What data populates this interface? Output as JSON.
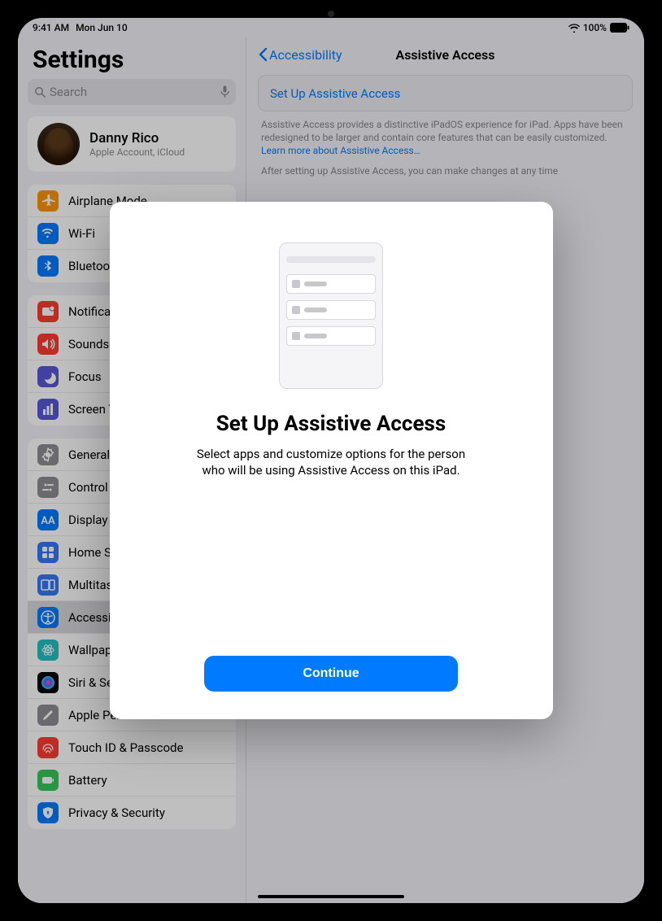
{
  "status": {
    "time": "9:41 AM",
    "date": "Mon Jun 10",
    "battery": "100%",
    "wifi": true
  },
  "sidebar": {
    "title": "Settings",
    "search_placeholder": "Search",
    "profile": {
      "name": "Danny Rico",
      "subtitle": "Apple Account, iCloud"
    },
    "sections": [
      {
        "items": [
          {
            "label": "Airplane Mode",
            "icon_color": "#ff9500",
            "icon_name": "airplane-icon"
          },
          {
            "label": "Wi-Fi",
            "icon_color": "#007aff",
            "icon_name": "wifi-icon"
          },
          {
            "label": "Bluetooth",
            "icon_color": "#007aff",
            "icon_name": "bluetooth-icon"
          }
        ]
      },
      {
        "items": [
          {
            "label": "Notifications",
            "icon_color": "#ff3b30",
            "icon_name": "notifications-icon"
          },
          {
            "label": "Sounds",
            "icon_color": "#ff3b30",
            "icon_name": "sounds-icon"
          },
          {
            "label": "Focus",
            "icon_color": "#5856d6",
            "icon_name": "focus-icon"
          },
          {
            "label": "Screen Time",
            "icon_color": "#5856d6",
            "icon_name": "screen-time-icon"
          }
        ]
      },
      {
        "items": [
          {
            "label": "General",
            "icon_color": "#8e8e93",
            "icon_name": "general-icon"
          },
          {
            "label": "Control Center",
            "icon_color": "#8e8e93",
            "icon_name": "control-center-icon"
          },
          {
            "label": "Display & Brightness",
            "icon_color": "#007aff",
            "icon_name": "display-icon"
          },
          {
            "label": "Home Screen & App Library",
            "icon_color": "#3478f6",
            "icon_name": "home-screen-icon"
          },
          {
            "label": "Multitasking & Gestures",
            "icon_color": "#3478f6",
            "icon_name": "multitasking-icon"
          },
          {
            "label": "Accessibility",
            "icon_color": "#007aff",
            "selected": true,
            "icon_name": "accessibility-icon"
          },
          {
            "label": "Wallpaper",
            "icon_color": "#22c1c3",
            "icon_name": "wallpaper-icon"
          },
          {
            "label": "Siri & Search",
            "icon_color": "#3a3a3c",
            "icon_name": "siri-icon",
            "siri": true
          },
          {
            "label": "Apple Pencil",
            "icon_color": "#8e8e93",
            "icon_name": "pencil-icon"
          },
          {
            "label": "Touch ID & Passcode",
            "icon_color": "#ff3b30",
            "icon_name": "touch-id-icon"
          },
          {
            "label": "Battery",
            "icon_color": "#34c759",
            "icon_name": "battery-icon"
          },
          {
            "label": "Privacy & Security",
            "icon_color": "#007aff",
            "icon_name": "privacy-icon"
          }
        ]
      }
    ]
  },
  "detail": {
    "back_label": "Accessibility",
    "title": "Assistive Access",
    "setup_link": "Set Up Assistive Access",
    "description_part1": "Assistive Access provides a distinctive iPadOS experience for iPad. Apps have been redesigned to be larger and contain core features that can be easily customized. ",
    "description_link": "Learn more about Assistive Access…",
    "description_part2": "After setting up Assistive Access, you can make changes at any time"
  },
  "modal": {
    "title": "Set Up Assistive Access",
    "body": "Select apps and customize options for the person who will be using Assistive Access on this iPad.",
    "continue": "Continue"
  }
}
